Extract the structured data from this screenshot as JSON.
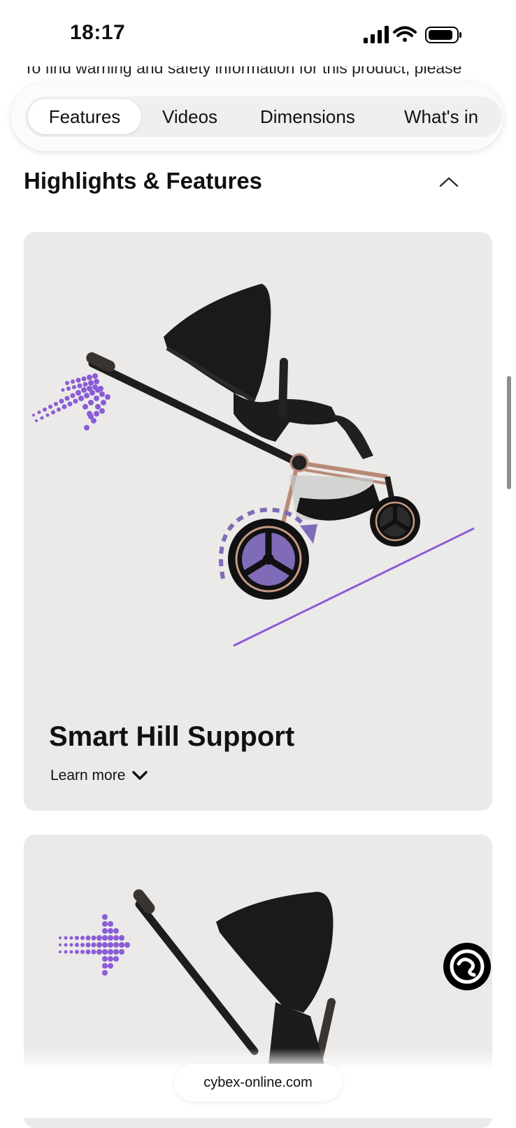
{
  "status_bar": {
    "time": "18:17"
  },
  "page": {
    "cut_text": "To find warning and safety information for this product, please"
  },
  "tabs": [
    {
      "label": "Features",
      "active": true
    },
    {
      "label": "Videos",
      "active": false
    },
    {
      "label": "Dimensions",
      "active": false
    },
    {
      "label": "What's in",
      "active": false
    }
  ],
  "section": {
    "title": "Highlights & Features",
    "expanded": true
  },
  "cards": [
    {
      "title": "Smart Hill Support",
      "learn_more": "Learn more"
    }
  ],
  "browser": {
    "url": "cybex-online.com"
  },
  "colors": {
    "accent": "#8b5cd6",
    "card_bg": "#ebeae8"
  }
}
